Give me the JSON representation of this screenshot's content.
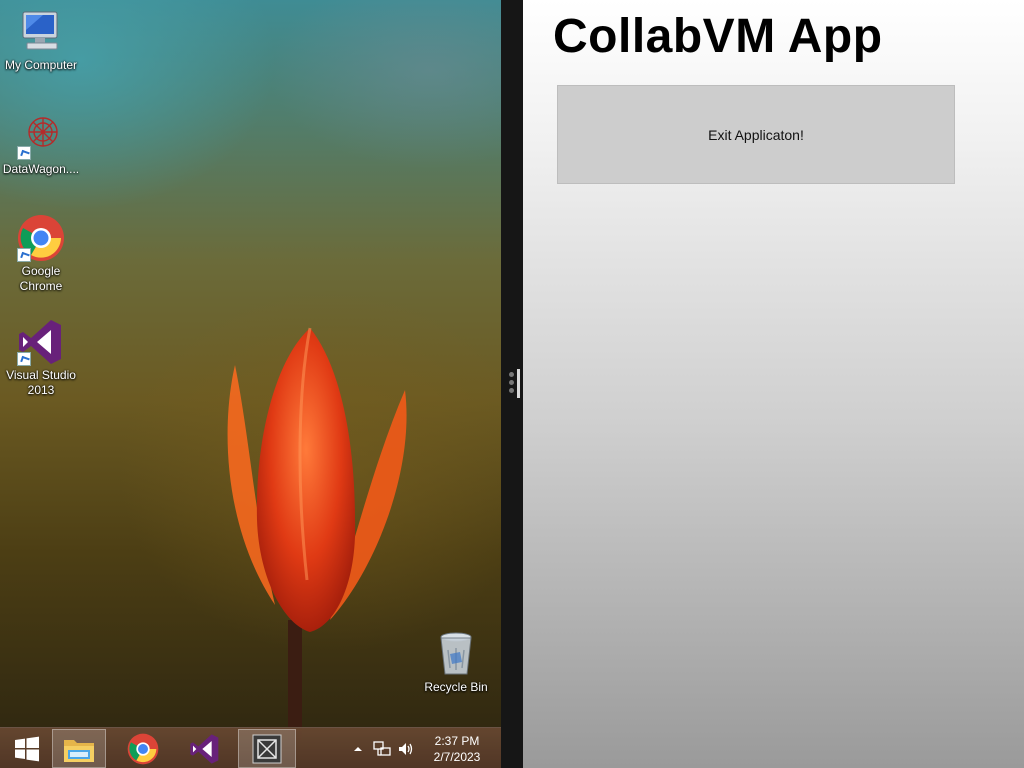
{
  "desktop": {
    "icons": [
      {
        "label": "My Computer"
      },
      {
        "label": "DataWagon...."
      },
      {
        "label": "Google\nChrome"
      },
      {
        "label": "Visual Studio\n2013"
      },
      {
        "label": "Recycle Bin"
      }
    ]
  },
  "taskbar": {
    "start_icon": "windows-logo-icon",
    "pinned": [
      "file-explorer-icon",
      "chrome-icon",
      "visual-studio-icon",
      "collabvm-app-icon"
    ],
    "tray_icons": [
      "show-hidden-icons",
      "network-icon",
      "volume-icon"
    ],
    "clock": {
      "time": "2:37 PM",
      "date": "2/7/2023"
    }
  },
  "app": {
    "title": "CollabVM App",
    "exit_button_label": "Exit Applicaton!"
  },
  "colors": {
    "app_background_top": "#ffffff",
    "app_background_bottom": "#9a9a9a",
    "button_background": "#cdcdcd",
    "splitter": "#161616",
    "taskbar": "#6a4a34"
  }
}
